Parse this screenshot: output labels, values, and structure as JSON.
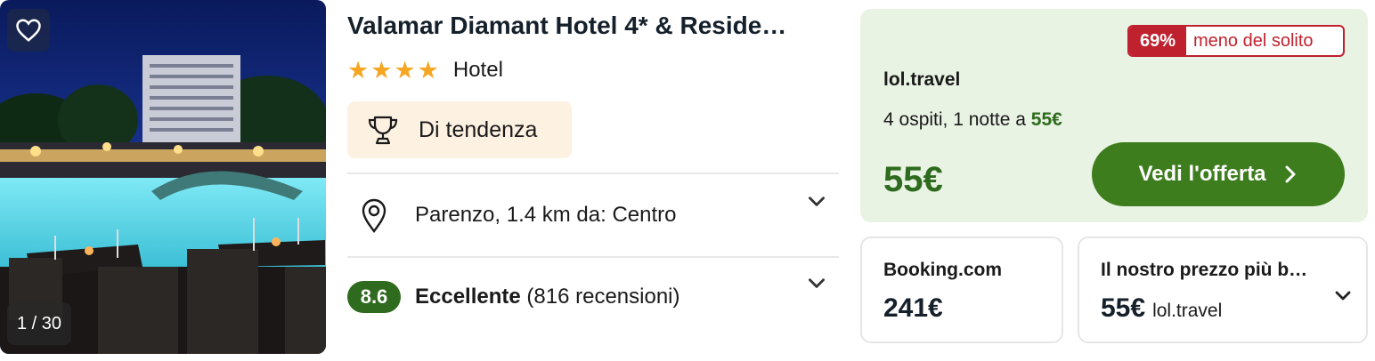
{
  "photo": {
    "counter": "1 / 30",
    "favorite_icon": "heart-icon"
  },
  "hotel": {
    "title": "Valamar Diamant Hotel 4* & Reside…",
    "stars": 4,
    "type": "Hotel",
    "trend_label": "Di tendenza",
    "location": "Parenzo, 1.4 km da: Centro",
    "rating_score": "8.6",
    "rating_label": "Eccellente",
    "rating_count": "(816 recensioni)"
  },
  "offer": {
    "discount_pct": "69%",
    "discount_text": "meno del solito",
    "provider": "lol.travel",
    "guests_text": "4 ospiti, 1 notte a",
    "guests_price": "55€",
    "price": "55€",
    "cta_label": "Vedi l'offerta"
  },
  "alternatives": [
    {
      "title": "Booking.com",
      "price": "241€"
    },
    {
      "title": "Il nostro prezzo più b…",
      "price": "55€",
      "provider": "lol.travel"
    }
  ],
  "colors": {
    "accent_green": "#3e7d1e",
    "price_green": "#2e6b1e",
    "discount_red": "#c0212e",
    "offer_bg": "#e9f3e3",
    "trend_bg": "#fdf1e2",
    "star": "#f5a623"
  }
}
